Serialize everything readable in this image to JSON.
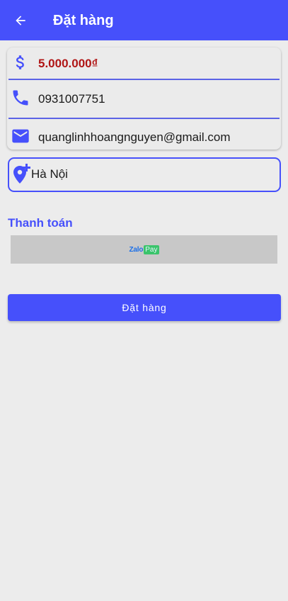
{
  "appbar": {
    "title": "Đặt hàng",
    "back_icon": "arrow-back-icon",
    "background": "#4650fb"
  },
  "info": {
    "price": "5.000.000₫",
    "phone": "0931007751",
    "email": "quanglinhhoangnguyen@gmail.com",
    "price_color": "#b01515"
  },
  "address": {
    "value": "Hà Nội",
    "icon": "add-location-icon"
  },
  "payment": {
    "section_title": "Thanh toán",
    "zalo_text": "Zalo",
    "pay_text": "Pay"
  },
  "order_button": {
    "label": "Đặt hàng"
  }
}
